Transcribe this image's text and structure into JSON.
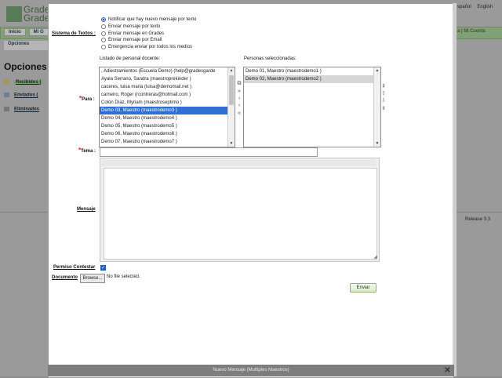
{
  "background": {
    "logo_text": "Grade\nGrade",
    "lang_options": [
      "spañol",
      "English"
    ],
    "account_text": "a | Mi Cuenta",
    "tabs": [
      "Inicio",
      "Mi G"
    ],
    "subtab": "Opciones",
    "page_title": "Opciones",
    "sidebar": [
      "Recibidos (",
      "Enviados (",
      "Eliminados"
    ],
    "release": "Release 3.3"
  },
  "form": {
    "sistema_label": "Sistema de Textos :",
    "radio_options": [
      {
        "label": "Notificar que hay nuevo mensaje por texto",
        "checked": true
      },
      {
        "label": "Enviar mensaje por texto",
        "checked": false
      },
      {
        "label": "Enviar mensaje en Grades",
        "checked": false
      },
      {
        "label": "Enviar mensaje por Email",
        "checked": false
      },
      {
        "label": "Emergencia enviar por todos los medios",
        "checked": false
      }
    ],
    "listado_label": "Listado de personal docente:",
    "seleccionadas_label": "Personas seleccionadas:",
    "para_label": "Para :",
    "docentes": [
      ", Adiestramientos (Escuela Demo) (help@gradesgarde",
      "Ayala Serrano, Sandra (maestroprekinder )",
      "caceres, luisa maria (luisa@demomail.net )",
      "carneiro, Roger (rcontreras@hotmail.com )",
      "Colón Díaz, Myriam (maestroseptimo )",
      "Demo 03, Maestro (maestrodemo3 )",
      "Demo 04, Maestro (maestrodemo4 )",
      "Demo 05, Maestro (maestrodemo5 )",
      "Demo 06, Maestro (maestrodemo6 )",
      "Demo 07, Maestro (maestrodemo7 )"
    ],
    "seleccionadas": [
      "Demo 01, Maestro (maestrodemo1 )",
      "Demo 02, Maestro (maestrodemo2 )"
    ],
    "tema_label": "Tema :",
    "tema_value": "",
    "mensaje_label": "Mensaje",
    "permiso_label": "Permiso Contestar",
    "permiso_checked": true,
    "documento_label": "Documento",
    "browse_label": "Browse...",
    "file_status": "No file selected.",
    "send_label": "Enviar"
  },
  "modal_title": "Nuevo Mensaje (Multiples Maestros)",
  "colors": {
    "selection": "#2f6fd1",
    "required": "#d32020",
    "overlay": "#8d8d8d"
  }
}
